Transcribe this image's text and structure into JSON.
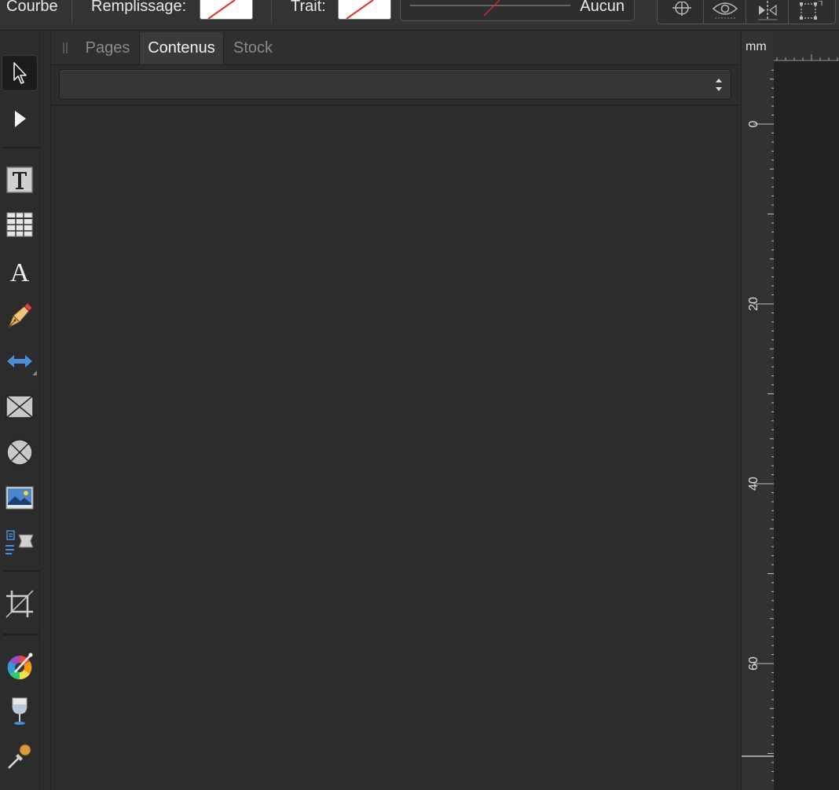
{
  "toolbar": {
    "context_label": "Courbe",
    "fill_label": "Remplissage:",
    "stroke_label": "Trait:",
    "stroke_style_value": "Aucun",
    "icons": [
      "snap-target-icon",
      "preview-eye-icon",
      "flip-horizontal-icon",
      "transform-box-icon"
    ]
  },
  "tools": [
    {
      "name": "move-tool-icon",
      "active": true
    },
    {
      "name": "node-tool-icon",
      "active": false
    },
    {
      "name": "frame-text-tool-icon",
      "active": false
    },
    {
      "name": "table-tool-icon",
      "active": false
    },
    {
      "name": "artistic-text-tool-icon",
      "active": false
    },
    {
      "name": "pen-tool-icon",
      "active": false
    },
    {
      "name": "measure-tool-icon",
      "active": false
    },
    {
      "name": "rectangle-frame-tool-icon",
      "active": false
    },
    {
      "name": "ellipse-frame-tool-icon",
      "active": false
    },
    {
      "name": "place-image-tool-icon",
      "active": false
    },
    {
      "name": "text-flow-tool-icon",
      "active": false
    },
    {
      "name": "crop-tool-icon",
      "active": false
    },
    {
      "name": "color-picker-tool-icon",
      "active": false
    },
    {
      "name": "transparency-tool-icon",
      "active": false
    },
    {
      "name": "eyedropper-tool-icon",
      "active": false
    }
  ],
  "panel": {
    "tabs": [
      "Pages",
      "Contenus",
      "Stock"
    ],
    "selected_tab": "Contenus",
    "dropdown_value": ""
  },
  "ruler": {
    "unit": "mm",
    "labels": [
      "0",
      "20",
      "40",
      "60"
    ]
  },
  "colors": {
    "background": "#2c2c2c",
    "panel": "#2d2d2d",
    "accent_blue": "#4a90d9",
    "none_swatch_line": "#e0302a"
  }
}
